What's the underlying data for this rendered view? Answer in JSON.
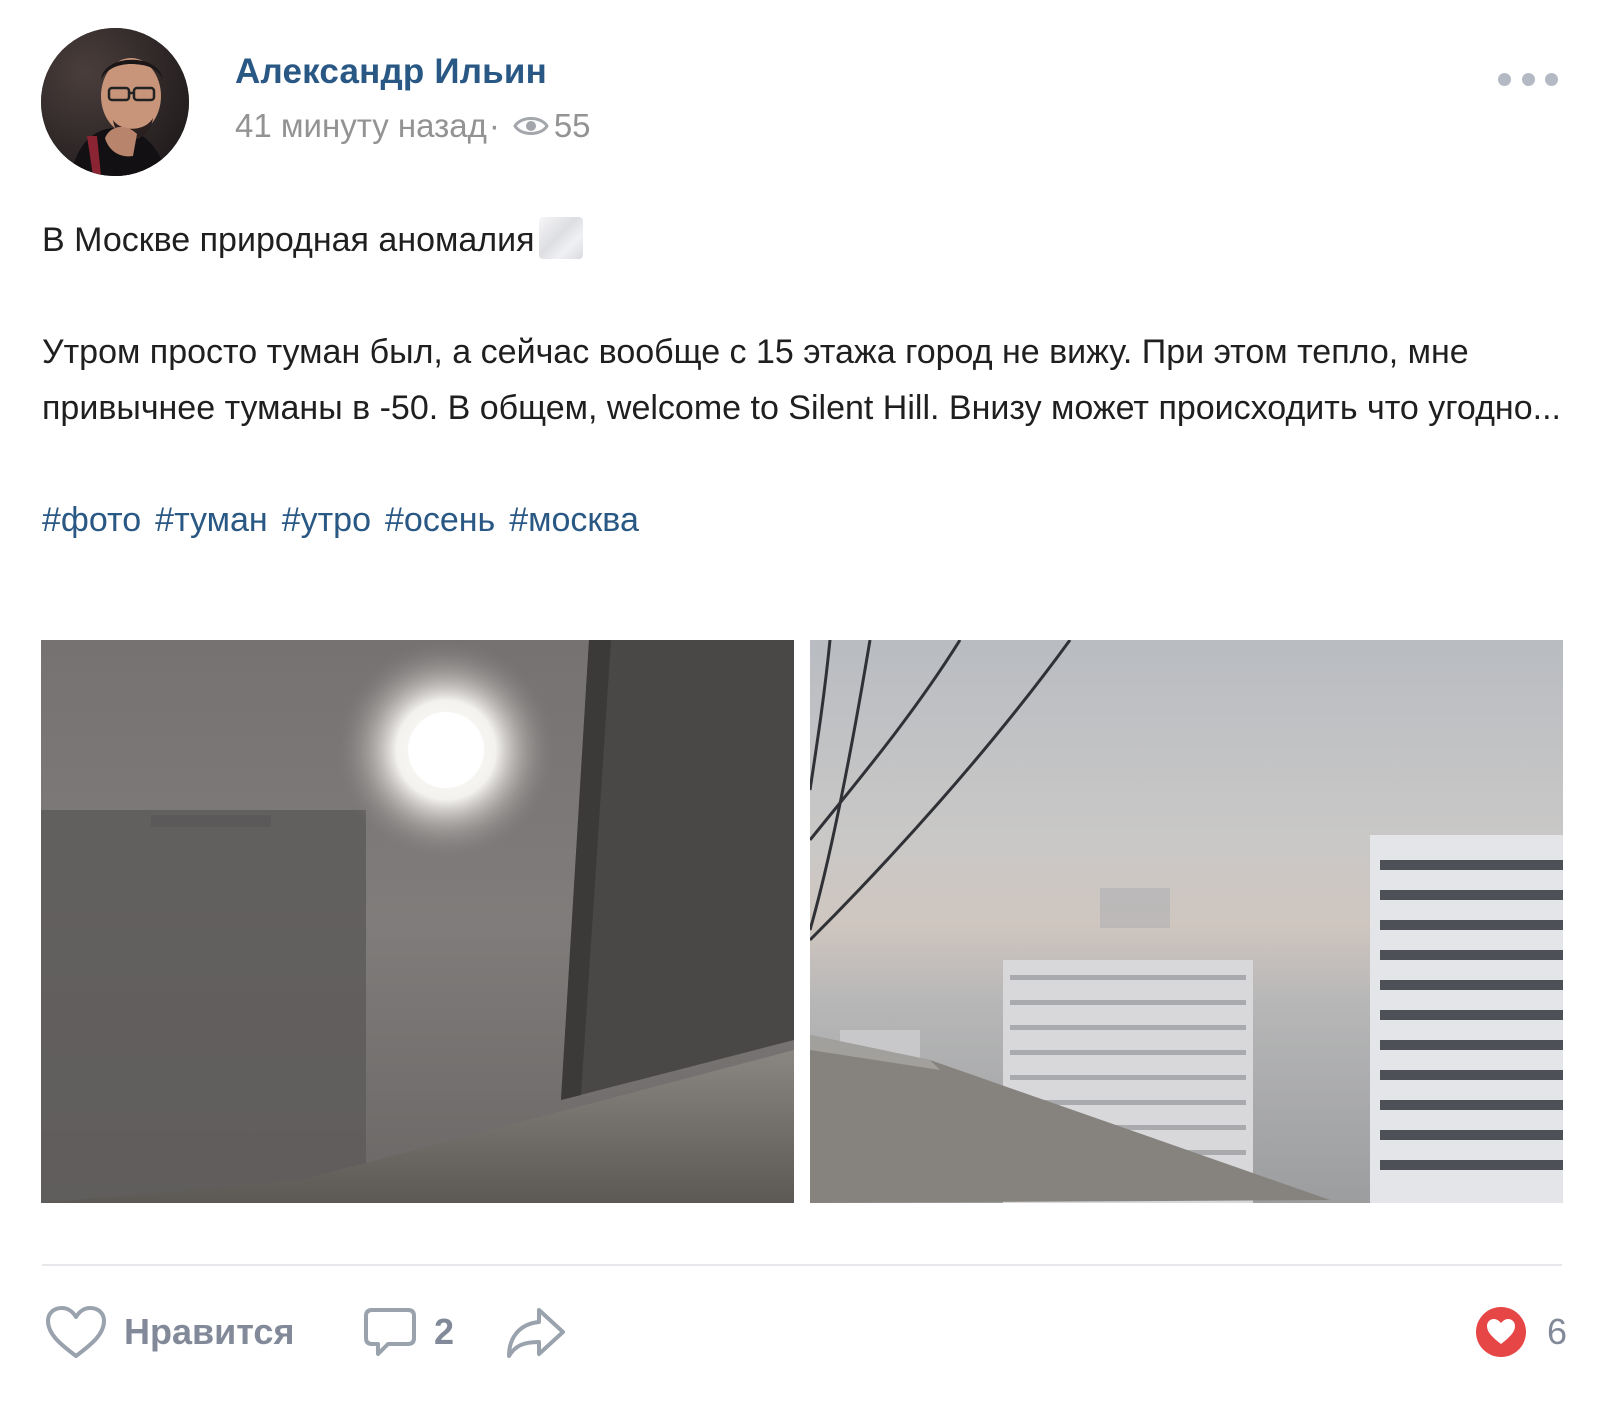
{
  "post": {
    "author": {
      "name": "Александр Ильин"
    },
    "time": "41 минуту назад",
    "separator": "·",
    "views": "55",
    "text": {
      "line1": "В Москве природная аномалия",
      "paragraph2": "Утром просто туман был, а сейчас вообще с 15 этажа город не вижу. При этом тепло, мне привычнее туманы в -50. В общем, welcome to Silent Hill. Внизу может происходить что угодно..."
    },
    "hashtags": [
      "#фото",
      "#туман",
      "#утро",
      "#осень",
      "#москва"
    ],
    "photos": [
      {
        "icon": "fog-sun-photo"
      },
      {
        "icon": "fog-buildings-photo"
      }
    ],
    "actions": {
      "like_label": "Нравится",
      "comments_count": "2",
      "likes_total": "6"
    },
    "icons": {
      "views": "eye-icon",
      "more": "more-dots-icon",
      "like": "heart-outline-icon",
      "comment": "comment-bubble-icon",
      "share": "share-arrow-icon",
      "likes_summary": "heart-filled-icon"
    },
    "colors": {
      "link": "#2a5885",
      "meta": "#939393",
      "action": "#828a99",
      "heart": "#e64646"
    }
  }
}
